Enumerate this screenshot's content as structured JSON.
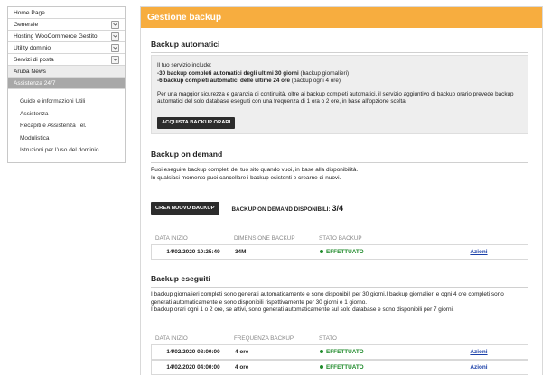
{
  "sidebar": {
    "items": [
      {
        "label": "Home Page",
        "dropdown": false,
        "style": "plain"
      },
      {
        "label": "Generale",
        "dropdown": true,
        "style": "plain"
      },
      {
        "label": "Hosting WooCommerce Gestito",
        "dropdown": true,
        "style": "plain"
      },
      {
        "label": "Utility dominio",
        "dropdown": true,
        "style": "plain"
      },
      {
        "label": "Servizi di posta",
        "dropdown": true,
        "style": "plain"
      },
      {
        "label": "Aruba News",
        "dropdown": false,
        "style": "gray"
      },
      {
        "label": "Assistenza 24/7",
        "dropdown": false,
        "style": "dark"
      }
    ],
    "subitems": [
      "Guide e informazioni Utili",
      "Assistenza",
      "Recapiti e Assistenza Tel.",
      "Modulistica",
      "Istruzioni per l’uso del dominio"
    ]
  },
  "main": {
    "title": "Gestione backup",
    "auto": {
      "title": "Backup automatici",
      "intro": "Il tuo servizio include:",
      "line1_bold": "-30 backup completi automatici degli ultimi 30 giorni",
      "line1_rest": " (backup giornalieri)",
      "line2_bold": "-6 backup completi automatici delle ultime 24 ore",
      "line2_rest": " (backup ogni 4 ore)",
      "desc": "Per una maggior sicurezza e garanzia di continuità, oltre ai backup completi automatici, il servizio aggiuntivo di backup orario prevede backup automatici del solo database eseguiti con una frequenza di 1 ora o 2 ore, in base all’opzione scelta.",
      "buy_button": "ACQUISTA BACKUP ORARI"
    },
    "ondemand": {
      "title": "Backup on demand",
      "desc1": "Puoi eseguire backup completi del tuo sito quando vuoi, in base alla disponibilità.",
      "desc2": "In qualsiasi momento puoi cancellare i backup esistenti e crearne di nuovi.",
      "create_button": "CREA NUOVO BACKUP",
      "available_label": "BACKUP ON DEMAND DISPONIBILI:",
      "available_value": "3/4",
      "headers": [
        "DATA INIZIO",
        "DIMENSIONE BACKUP",
        "STATO BACKUP"
      ],
      "rows": [
        {
          "date": "14/02/2020 10:25:49",
          "size": "34M",
          "status": "EFFETTUATO",
          "action": "Azioni"
        }
      ]
    },
    "done": {
      "title": "Backup eseguiti",
      "desc1": "I backup giornalieri completi sono generati automaticamente e sono disponibili per 30 giorni.I backup giornalieri e ogni 4 ore completi sono",
      "desc2": "generati automaticamente e sono disponibili rispettivamente per 30 giorni e 1 giorno.",
      "desc3": "I backup orari ogni 1 o 2 ore, se attivi, sono generati automaticamente sul solo database e sono disponibili per 7 giorni.",
      "headers": [
        "DATA INIZIO",
        "FREQUENZA BACKUP",
        "STATO"
      ],
      "rows": [
        {
          "date": "14/02/2020 08:00:00",
          "freq": "4 ore",
          "status": "EFFETTUATO",
          "action": "Azioni"
        },
        {
          "date": "14/02/2020 04:00:00",
          "freq": "4 ore",
          "status": "EFFETTUATO",
          "action": "Azioni"
        }
      ]
    }
  },
  "colors": {
    "header": "#f7ad3f",
    "status_green": "#1e8a2a",
    "link": "#1a3fa8"
  }
}
